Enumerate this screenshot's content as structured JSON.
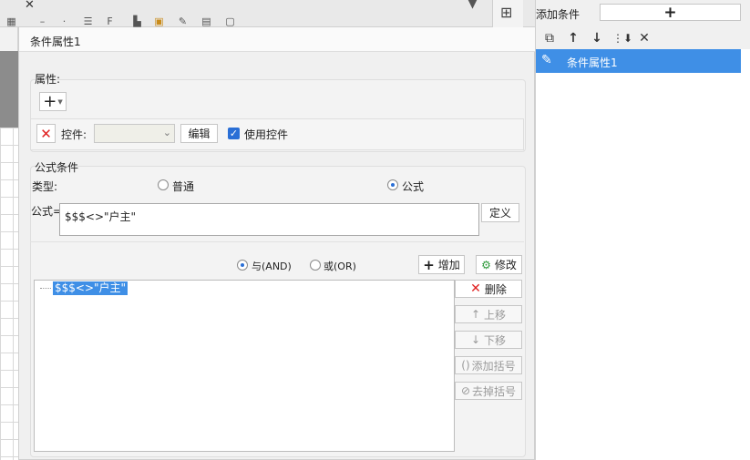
{
  "dialog": {
    "title": "条件属性1"
  },
  "attributes": {
    "section_label": "属性:",
    "add_glyph": "+",
    "control_label": "控件:",
    "control_value": "",
    "edit_button": "编辑",
    "use_control_label": "使用控件",
    "use_control_checked": true
  },
  "formula": {
    "section_label": "公式条件",
    "type_label": "类型:",
    "type_options": [
      "普通",
      "公式"
    ],
    "type_selected": "公式",
    "formula_label": "公式=",
    "formula_value": "$$$<>\"户主\"",
    "define_button": "定义",
    "logic_and": "与(AND)",
    "logic_or": "或(OR)",
    "logic_selected": "与(AND)",
    "add_button": "增加",
    "modify_button": "修改",
    "conditions": [
      "$$$<>\"户主\""
    ],
    "delete_button": "删除",
    "move_up_button": "上移",
    "move_down_button": "下移",
    "add_bracket_button": "添加括号",
    "remove_bracket_button": "去掉括号"
  },
  "right_panel": {
    "title": "添加条件",
    "add_glyph": "+",
    "items": [
      "条件属性1"
    ]
  },
  "colors": {
    "accent": "#3f8fe6",
    "delete_red": "#e02020",
    "dialog_bg": "#f0f0f0"
  }
}
